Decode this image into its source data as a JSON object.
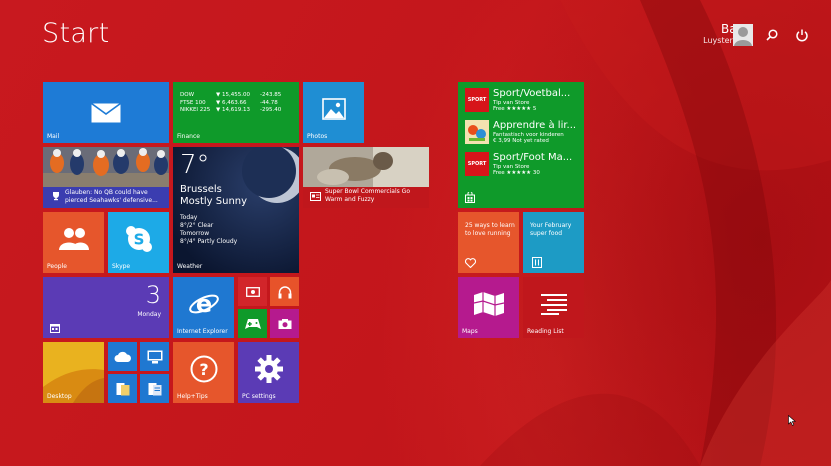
{
  "header": {
    "title": "Start",
    "user_name": "Bavo",
    "user_location": "Luysterborg"
  },
  "icons": {
    "search": "search-icon",
    "power": "power-icon",
    "avatar": "user-avatar-icon"
  },
  "tiles": {
    "mail": {
      "label": "Mail",
      "color": "#1e7bd6"
    },
    "finance": {
      "label": "Finance",
      "color": "#0f9a2a",
      "rows": [
        {
          "index": "DOW",
          "value": "▼ 15,455.00",
          "change": "-243.85"
        },
        {
          "index": "FTSE 100",
          "value": "▼ 6,463.66",
          "change": "-44.78"
        },
        {
          "index": "NIKKEI 225",
          "value": "▼ 14,619.13",
          "change": "-295.40"
        }
      ]
    },
    "photos": {
      "label": "Photos",
      "color": "#1f8ed3"
    },
    "sports": {
      "headline": "Glauben: No QB could have pierced Seahawks' defensive...",
      "color": "#3b3db0"
    },
    "weather": {
      "label": "Weather",
      "temp": "7°",
      "city": "Brussels",
      "condition": "Mostly Sunny",
      "today_label": "Today",
      "today_forecast": "8°/2° Clear",
      "tomorrow_label": "Tomorrow",
      "tomorrow_forecast": "8°/4° Partly Cloudy"
    },
    "news": {
      "headline": "Super Bowl Commercials Go Warm and Fuzzy",
      "color": "#c0171c"
    },
    "people": {
      "label": "People",
      "color": "#e6562c"
    },
    "skype": {
      "label": "Skype",
      "color": "#1daae7"
    },
    "calendar": {
      "day": "3",
      "weekday": "Monday",
      "color": "#5b3bb5"
    },
    "ie": {
      "label": "Internet Explorer",
      "color": "#1f78d1"
    },
    "video": {
      "color": "#d2252a"
    },
    "music": {
      "color": "#e7532a"
    },
    "games": {
      "color": "#0f9a2a"
    },
    "camera": {
      "color": "#b51a8e"
    },
    "desktop": {
      "label": "Desktop",
      "color": "#e3a21a"
    },
    "onedrive": {
      "color": "#1f78d1"
    },
    "thispc": {
      "color": "#1f78d1"
    },
    "explorer": {
      "color": "#1f78d1"
    },
    "docs": {
      "color": "#1f78d1"
    },
    "help": {
      "label": "Help+Tips",
      "color": "#e6562c"
    },
    "pcsettings": {
      "label": "PC settings",
      "color": "#5b3bb5"
    },
    "store": {
      "color": "#0f9a2a",
      "apps": [
        {
          "logo": "SPORT",
          "title": "Sport/Voetbal...",
          "publisher": "Tip van Store",
          "price": "Free ★★★★★ 5"
        },
        {
          "logo": "",
          "title": "Apprendre à lir...",
          "publisher": "Fantastisch voor kinderen",
          "price": "€ 3,99 Not yet rated"
        },
        {
          "logo": "SPORT",
          "title": "Sport/Foot Ma...",
          "publisher": "Tip van Store",
          "price": "Free ★★★★★ 30"
        }
      ]
    },
    "health": {
      "text": "25 ways to learn to love running",
      "color": "#e6562c"
    },
    "food": {
      "text": "Your February super food",
      "color": "#1d9bc5"
    },
    "maps": {
      "label": "Maps",
      "color": "#b51a8e"
    },
    "readinglist": {
      "label": "Reading List",
      "color": "#c0171c"
    }
  }
}
